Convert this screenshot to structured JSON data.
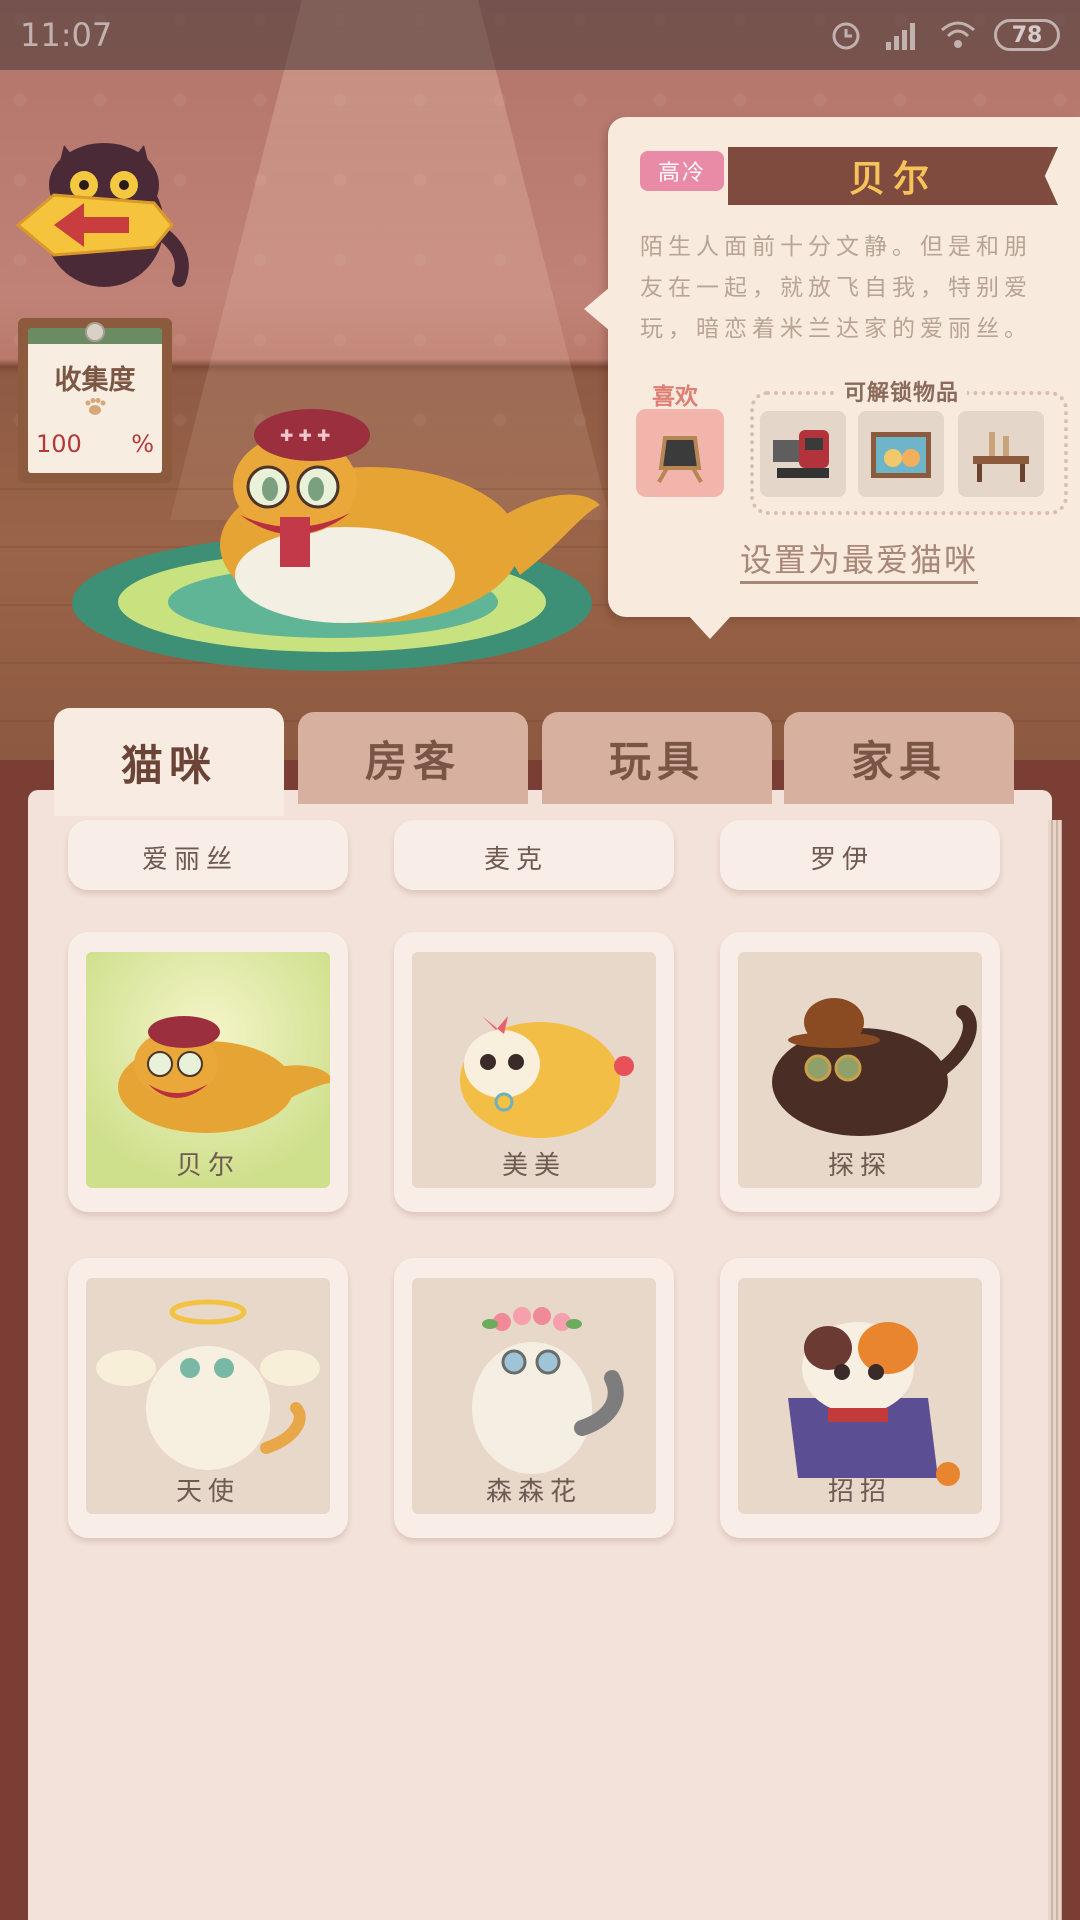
{
  "status_bar": {
    "time": "11:07",
    "battery": "78"
  },
  "collection": {
    "title": "收集度",
    "value": "100",
    "unit": "%"
  },
  "selected_cat": {
    "trait": "高冷",
    "name": "贝尔",
    "description": "陌生人面前十分文静。但是和朋友在一起，就放飞自我，特别爱玩，暗恋着米兰达家的爱丽丝。",
    "likes_label": "喜欢",
    "unlock_label": "可解锁物品",
    "favorite_link": "设置为最爱猫咪"
  },
  "tabs": [
    {
      "label": "猫咪",
      "active": true
    },
    {
      "label": "房客",
      "active": false
    },
    {
      "label": "玩具",
      "active": false
    },
    {
      "label": "家具",
      "active": false
    }
  ],
  "cats": [
    {
      "name": "爱丽丝"
    },
    {
      "name": "麦克"
    },
    {
      "name": "罗伊"
    },
    {
      "name": "贝尔"
    },
    {
      "name": "美美"
    },
    {
      "name": "探探"
    },
    {
      "name": "天使"
    },
    {
      "name": "森森花"
    },
    {
      "name": "招招"
    }
  ],
  "colors": {
    "accent_name": "#f6c35b",
    "trait_badge": "#e98aa6",
    "tab_active": "#f7ebe2",
    "tab_inactive": "#d7b09f",
    "selected_card": "#cfe08d"
  }
}
